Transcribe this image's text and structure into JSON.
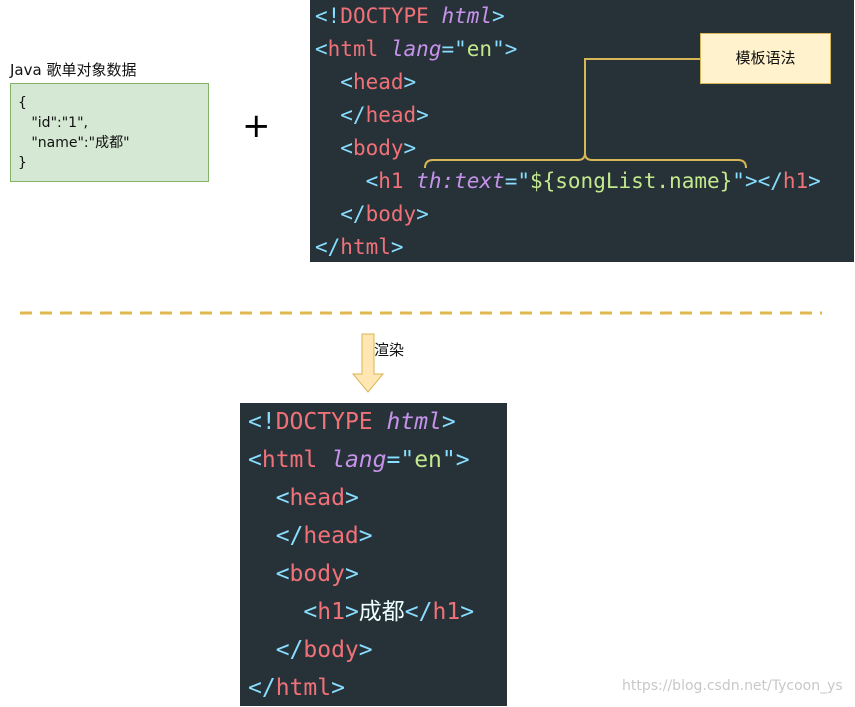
{
  "data_panel": {
    "label": "Java 歌单对象数据",
    "lines": [
      "{",
      "   \"id\":\"1\",",
      "   \"name\":\"成都\"",
      "}"
    ]
  },
  "plus_sign": "+",
  "template_code": {
    "doctype_open": "<!",
    "doctype_word": "DOCTYPE",
    "doctype_attr": "html",
    "html_tag": "html",
    "lang_attr": "lang",
    "lang_value": "en",
    "head_tag": "head",
    "body_tag": "body",
    "h1_tag": "h1",
    "th_attr": "th:text",
    "th_value": "${songList.name}"
  },
  "annotation": {
    "label": "模板语法"
  },
  "render_step": {
    "label": "渲染"
  },
  "rendered_code": {
    "h1_content": "成都"
  },
  "watermark": "https://blog.csdn.net/Tycoon_ys",
  "colors": {
    "code_bg": "#263238",
    "punctuation": "#89ddff",
    "tag": "#f07178",
    "attribute": "#c792ea",
    "string": "#c3e88d",
    "data_box_fill": "#d5e8d4",
    "data_box_border": "#82b366",
    "note_fill": "#fff2cc",
    "note_border": "#d6b656",
    "divider": "#e0b84f",
    "arrow_fill": "#ffe6b3"
  }
}
